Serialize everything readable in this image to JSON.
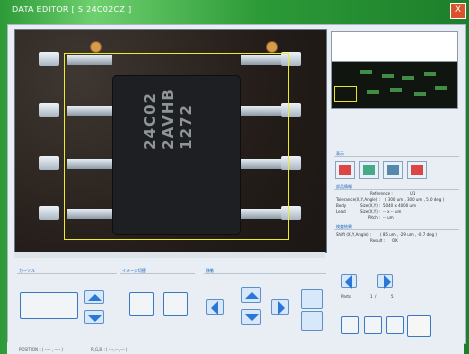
{
  "window": {
    "title": "DATA EDITOR [ S 24C02CZ ]",
    "close_symbol": "X"
  },
  "view": {
    "chip_text": [
      "24C02",
      "2AVHB",
      "1272"
    ],
    "thumbnails": {
      "count": 8
    }
  },
  "sections": {
    "zoom_title": "表示",
    "info_title": "部品情報",
    "result_title": "検査結果",
    "bottom_left_title": "カーソル",
    "bottom_mid_title": "イメージ切替",
    "bottom_right_title": "移動"
  },
  "info": {
    "reference_label": "Reference :",
    "reference_value": "U1",
    "tolerance_label": "Tolerance(X,Y,Angle) :",
    "tolerance_value": "( 300 um , 300 um , 5.0 deg )",
    "body_label": "Body",
    "body_size_label": "Size(X,Y) :",
    "body_size_value": "5040 x 4000 um",
    "lead_label": "Lead",
    "lead_size_label": "Size(X,Y) :",
    "lead_size_value": "-- x -- um",
    "pitch_label": "Pitch :",
    "pitch_value": "-- um"
  },
  "result": {
    "shift_label": "Shift (X,Y,Angle) :",
    "shift_value": "( 85 um , -29 um , -0.7 deg )",
    "result_label": "Result :",
    "result_value": "OK"
  },
  "parts": {
    "label": "Parts",
    "current": "1",
    "slash": "/",
    "total": "5"
  },
  "status": {
    "position_label": "POSITION : ( ---- , ---- )",
    "rgb_label": "R,G,B : ( ---,---,--- )"
  },
  "colors": {
    "accent": "#3a78c4",
    "arrow": "#2a77d8",
    "yellow_box": "#ecec2a"
  }
}
